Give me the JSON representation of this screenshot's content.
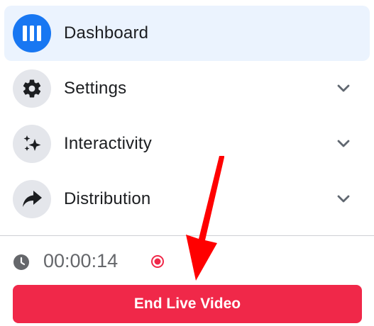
{
  "menu": {
    "items": [
      {
        "label": "Dashboard",
        "icon": "dashboard-icon",
        "active": true
      },
      {
        "label": "Settings",
        "icon": "gear-icon",
        "active": false
      },
      {
        "label": "Interactivity",
        "icon": "sparkles-icon",
        "active": false
      },
      {
        "label": "Distribution",
        "icon": "share-arrow-icon",
        "active": false
      }
    ]
  },
  "status": {
    "timer": "00:00:14",
    "icon": "clock-icon",
    "live_indicator": "record-icon"
  },
  "actions": {
    "end_live_label": "End Live Video"
  },
  "colors": {
    "accent": "#1877f2",
    "active_bg": "#ebf3fe",
    "danger": "#f02849",
    "annotation": "#ff0000"
  }
}
